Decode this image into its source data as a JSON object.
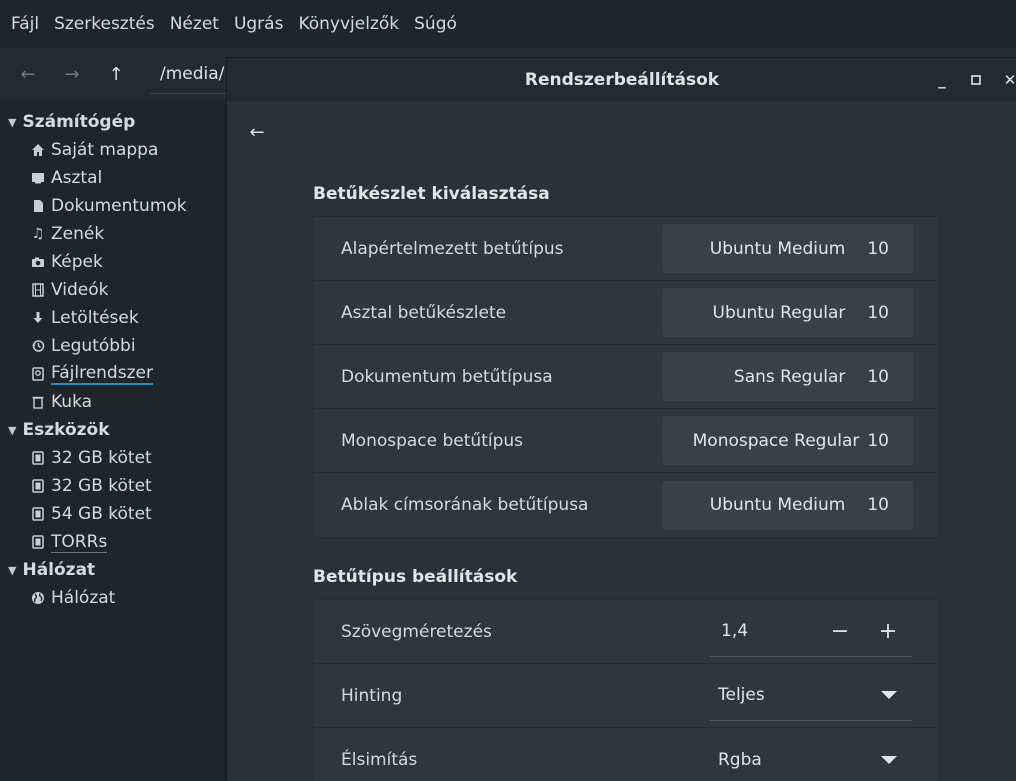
{
  "menubar": [
    "Fájl",
    "Szerkesztés",
    "Nézet",
    "Ugrás",
    "Könyvjelzők",
    "Súgó"
  ],
  "toolbar": {
    "path": "/media/",
    "back_icon": "arrow-left-icon",
    "forward_icon": "arrow-right-icon",
    "up_icon": "arrow-up-icon"
  },
  "sidebar": {
    "computer": {
      "header": "Számítógép",
      "items": [
        {
          "label": "Saját mappa",
          "icon": "home-icon"
        },
        {
          "label": "Asztal",
          "icon": "desktop-icon"
        },
        {
          "label": "Dokumentumok",
          "icon": "document-icon"
        },
        {
          "label": "Zenék",
          "icon": "music-icon"
        },
        {
          "label": "Képek",
          "icon": "camera-icon"
        },
        {
          "label": "Videók",
          "icon": "film-icon"
        },
        {
          "label": "Letöltések",
          "icon": "download-icon"
        },
        {
          "label": "Legutóbbi",
          "icon": "history-icon"
        },
        {
          "label": "Fájlrendszer",
          "icon": "filesystem-icon"
        },
        {
          "label": "Kuka",
          "icon": "trash-icon"
        }
      ]
    },
    "devices": {
      "header": "Eszközök",
      "items": [
        {
          "label": "32 GB kötet",
          "icon": "drive-icon"
        },
        {
          "label": "32 GB kötet",
          "icon": "drive-icon"
        },
        {
          "label": "54 GB kötet",
          "icon": "drive-icon"
        },
        {
          "label": "TORRs",
          "icon": "drive-icon"
        }
      ]
    },
    "network": {
      "header": "Hálózat",
      "items": [
        {
          "label": "Hálózat",
          "icon": "globe-icon"
        }
      ]
    }
  },
  "settings": {
    "title": "Rendszerbeállítások",
    "fonts_section": {
      "title": "Betűkészlet kiválasztása",
      "rows": [
        {
          "label": "Alapértelmezett betűtípus",
          "font": "Ubuntu Medium",
          "size": "10"
        },
        {
          "label": "Asztal betűkészlete",
          "font": "Ubuntu Regular",
          "size": "10"
        },
        {
          "label": "Dokumentum betűtípusa",
          "font": "Sans Regular",
          "size": "10"
        },
        {
          "label": "Monospace betűtípus",
          "font": "Monospace Regular",
          "size": "10"
        },
        {
          "label": "Ablak címsorának betűtípusa",
          "font": "Ubuntu Medium",
          "size": "10"
        }
      ]
    },
    "options_section": {
      "title": "Betűtípus beállítások",
      "scaling": {
        "label": "Szövegméretezés",
        "value": "1,4",
        "minus": "−",
        "plus": "+"
      },
      "hinting": {
        "label": "Hinting",
        "value": "Teljes"
      },
      "antialias": {
        "label": "Élsimítás",
        "value": "Rgba"
      }
    }
  }
}
